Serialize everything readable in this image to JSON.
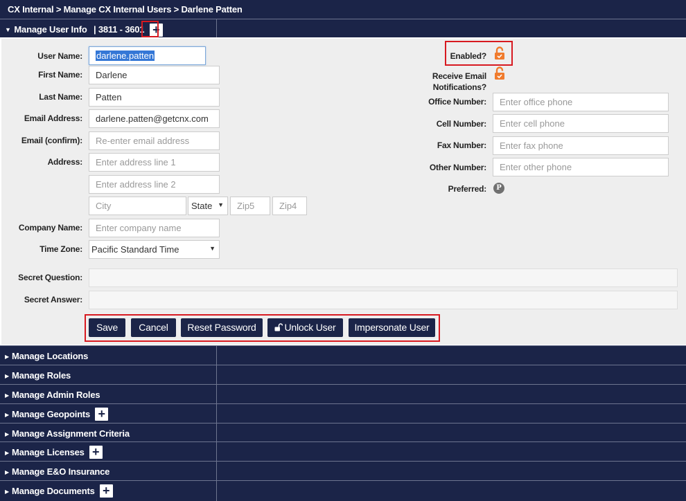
{
  "breadcrumb": "CX Internal > Manage CX Internal Users > Darlene Patten",
  "manage_user_info": {
    "title": "Manage User Info",
    "id_range": "| 3811 - 3601",
    "add_icon": "plus-icon"
  },
  "form": {
    "user_name": {
      "label": "User Name:",
      "value": "darlene.patten"
    },
    "first_name": {
      "label": "First Name:",
      "value": "Darlene"
    },
    "last_name": {
      "label": "Last Name:",
      "value": "Patten"
    },
    "email": {
      "label": "Email Address:",
      "value": "darlene.patten@getcnx.com"
    },
    "email_confirm": {
      "label": "Email (confirm):",
      "placeholder": "Re-enter email address"
    },
    "address": {
      "label": "Address:",
      "line1_placeholder": "Enter address line 1",
      "line2_placeholder": "Enter address line 2",
      "city_placeholder": "City",
      "state_value": "State",
      "zip5_placeholder": "Zip5",
      "zip4_placeholder": "Zip4"
    },
    "company_name": {
      "label": "Company Name:",
      "placeholder": "Enter company name"
    },
    "time_zone": {
      "label": "Time Zone:",
      "value": "Pacific Standard Time"
    },
    "secret_question": {
      "label": "Secret Question:"
    },
    "secret_answer": {
      "label": "Secret Answer:"
    },
    "enabled": {
      "label": "Enabled?",
      "icon": "unlocked-lock-icon",
      "color": "#f07b2d"
    },
    "receive_email": {
      "label_line1": "Receive Email",
      "label_line2": "Notifications?",
      "icon": "unlocked-lock-icon"
    },
    "office_number": {
      "label": "Office Number:",
      "placeholder": "Enter office phone"
    },
    "cell_number": {
      "label": "Cell Number:",
      "placeholder": "Enter cell phone"
    },
    "fax_number": {
      "label": "Fax Number:",
      "placeholder": "Enter fax phone"
    },
    "other_number": {
      "label": "Other Number:",
      "placeholder": "Enter other phone"
    },
    "preferred": {
      "label": "Preferred:",
      "icon_letter": "P"
    }
  },
  "buttons": {
    "save": "Save",
    "cancel": "Cancel",
    "reset_password": "Reset Password",
    "unlock_user": "Unlock User",
    "impersonate_user": "Impersonate User"
  },
  "sections": [
    {
      "title": "Manage Locations",
      "has_add": false
    },
    {
      "title": "Manage Roles",
      "has_add": false
    },
    {
      "title": "Manage Admin Roles",
      "has_add": false
    },
    {
      "title": "Manage Geopoints",
      "has_add": true
    },
    {
      "title": "Manage Assignment Criteria",
      "has_add": false
    },
    {
      "title": "Manage Licenses",
      "has_add": true
    },
    {
      "title": "Manage E&O Insurance",
      "has_add": false
    },
    {
      "title": "Manage Documents",
      "has_add": true
    }
  ],
  "colors": {
    "navy": "#1b2448",
    "highlight_red": "#d71920",
    "lock_orange": "#f07b2d",
    "panel_bg": "#eeeeee"
  }
}
